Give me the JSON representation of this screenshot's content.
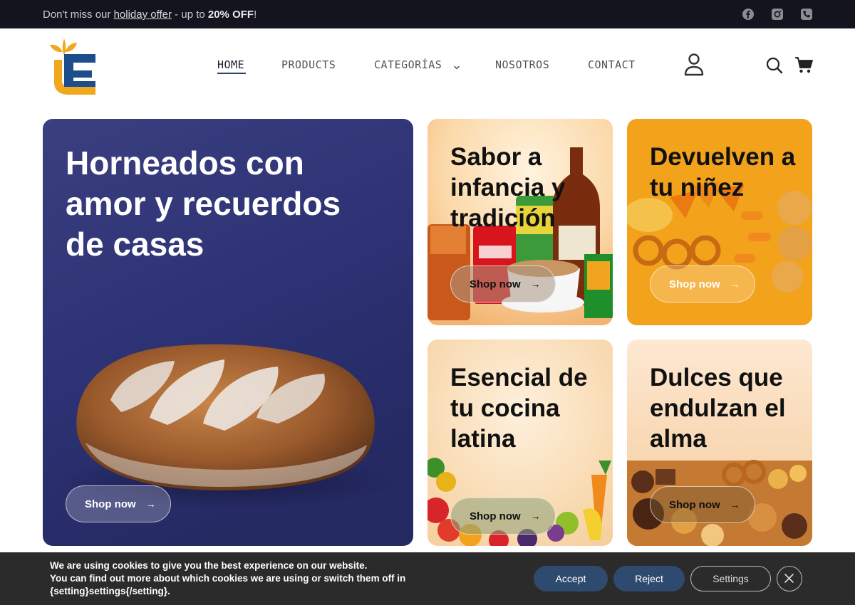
{
  "topbar": {
    "promo_prefix": "Don't miss our ",
    "promo_link": "holiday offer",
    "promo_middle": " - up to ",
    "promo_bold": "20% OFF",
    "promo_suffix": "!"
  },
  "nav": {
    "items": [
      {
        "label": "HOME"
      },
      {
        "label": "PRODUCTS"
      },
      {
        "label": "CATEGORÍAS"
      },
      {
        "label": "NOSOTROS"
      },
      {
        "label": "CONTACT"
      }
    ]
  },
  "hero": {
    "title": "Horneados con amor y recuerdos de casas",
    "button": "Shop now"
  },
  "cards": [
    {
      "title": "Sabor a infancia y tradición",
      "button": "Shop now"
    },
    {
      "title": "Devuelven a tu niñez",
      "button": "Shop now"
    },
    {
      "title": "Esencial de tu cocina latina",
      "button": "Shop now"
    },
    {
      "title": "Dulces que endulzan el alma",
      "button": "Shop now"
    }
  ],
  "arrow": "→",
  "cookie": {
    "line1": "We are using cookies to give you the best experience on our website.",
    "line2": "You can find out more about which cookies we are using or switch them off in {setting}settings{/setting}.",
    "accept": "Accept",
    "reject": "Reject",
    "settings": "Settings"
  },
  "colors": {
    "topbar": "#14141e",
    "hero_bg": "#2b3170",
    "orange_card": "#f2a21b",
    "cookie_bg": "#2b2b2b",
    "accent_button": "#2e4a6e",
    "logo_orange": "#f0a81e",
    "logo_blue": "#1e4d8c"
  },
  "icons": [
    "facebook-icon",
    "instagram-icon",
    "phone-icon",
    "user-icon",
    "search-icon",
    "cart-icon",
    "chevron-down-icon",
    "close-icon"
  ]
}
